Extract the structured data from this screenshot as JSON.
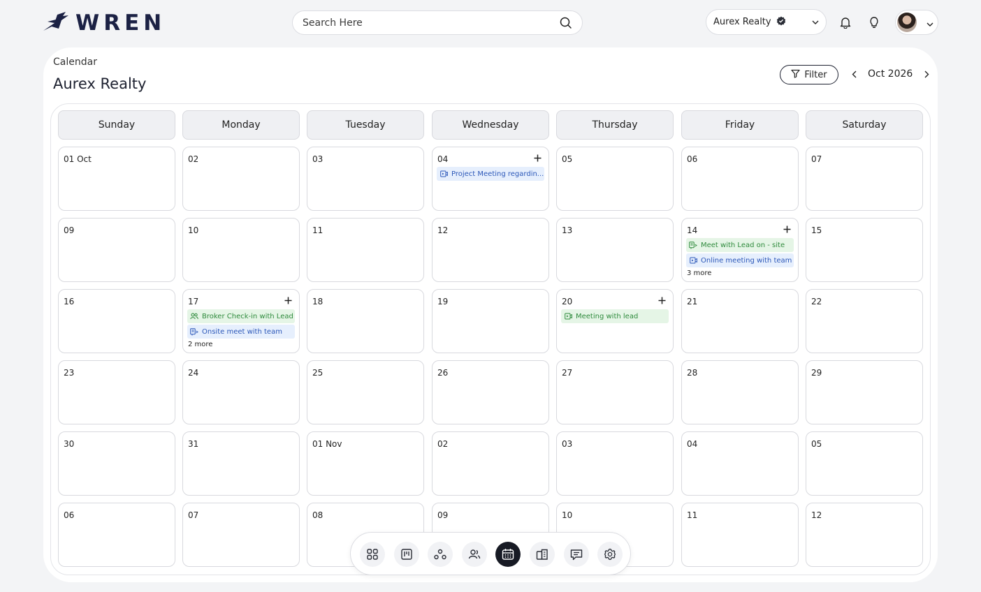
{
  "brand": {
    "name": "WREN"
  },
  "search": {
    "placeholder": "Search Here",
    "icon": "search-icon"
  },
  "org_selector": {
    "name": "Aurex Realty",
    "verified_icon": "verified-badge-icon"
  },
  "page": {
    "breadcrumb": "Calendar",
    "title": "Aurex Realty"
  },
  "toolbar": {
    "filter_label": "Filter",
    "current_month": "Oct 2026"
  },
  "weekdays": [
    "Sunday",
    "Monday",
    "Tuesday",
    "Wednesday",
    "Thursday",
    "Friday",
    "Saturday"
  ],
  "weeks": [
    [
      {
        "label": "01 Oct"
      },
      {
        "label": "02"
      },
      {
        "label": "03"
      },
      {
        "label": "04",
        "add": true,
        "events": [
          {
            "title": "Project Meeting regardin...",
            "color": "blue",
            "icon": "video-icon"
          }
        ]
      },
      {
        "label": "05"
      },
      {
        "label": "06"
      },
      {
        "label": "07"
      }
    ],
    [
      {
        "label": "09"
      },
      {
        "label": "10"
      },
      {
        "label": "11"
      },
      {
        "label": "12"
      },
      {
        "label": "13"
      },
      {
        "label": "14",
        "add": true,
        "events": [
          {
            "title": "Meet with Lead on - site",
            "color": "green",
            "icon": "onsite-icon"
          },
          {
            "title": "Online meeting with team",
            "color": "blue",
            "icon": "video-icon"
          }
        ],
        "more": "3 more"
      },
      {
        "label": "15"
      }
    ],
    [
      {
        "label": "16"
      },
      {
        "label": "17",
        "add": true,
        "events": [
          {
            "title": "Broker Check-in with Lead",
            "color": "green",
            "icon": "people-icon"
          },
          {
            "title": "Onsite meet with team",
            "color": "blue",
            "icon": "onsite-icon"
          }
        ],
        "more": "2 more"
      },
      {
        "label": "18"
      },
      {
        "label": "19"
      },
      {
        "label": "20",
        "add": true,
        "events": [
          {
            "title": "Meeting  with lead",
            "color": "green",
            "icon": "video-icon"
          }
        ]
      },
      {
        "label": "21"
      },
      {
        "label": "22"
      }
    ],
    [
      {
        "label": "23"
      },
      {
        "label": "24"
      },
      {
        "label": "25"
      },
      {
        "label": "26"
      },
      {
        "label": "27"
      },
      {
        "label": "28"
      },
      {
        "label": "29"
      }
    ],
    [
      {
        "label": "30"
      },
      {
        "label": "31"
      },
      {
        "label": "01 Nov"
      },
      {
        "label": "02"
      },
      {
        "label": "03"
      },
      {
        "label": "04"
      },
      {
        "label": "05"
      }
    ],
    [
      {
        "label": "06"
      },
      {
        "label": "07"
      },
      {
        "label": "08"
      },
      {
        "label": "09"
      },
      {
        "label": "10"
      },
      {
        "label": "11"
      },
      {
        "label": "12"
      }
    ]
  ],
  "dock": [
    {
      "name": "dashboard-icon"
    },
    {
      "name": "board-icon"
    },
    {
      "name": "network-icon"
    },
    {
      "name": "users-icon"
    },
    {
      "name": "calendar-icon",
      "active": true
    },
    {
      "name": "buildings-icon"
    },
    {
      "name": "chat-icon"
    },
    {
      "name": "settings-icon"
    }
  ],
  "colors": {
    "accent_dark": "#171a24",
    "event_blue_bg": "#e6effd",
    "event_blue_text": "#2b57b8",
    "event_green_bg": "#e5f5e6",
    "event_green_text": "#2e8a3c"
  }
}
